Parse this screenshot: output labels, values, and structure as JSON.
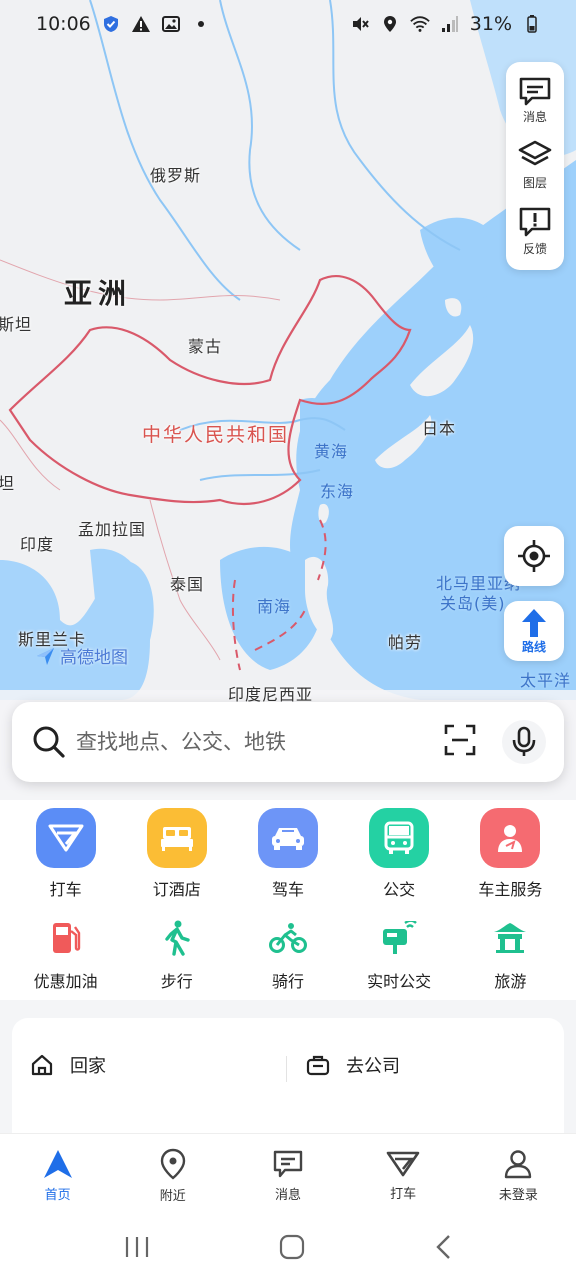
{
  "status_bar": {
    "time": "10:06",
    "battery": "31%"
  },
  "map": {
    "continent_label": "亚洲",
    "labels": {
      "russia": "俄罗斯",
      "mongolia": "蒙古",
      "china": "中华人民共和国",
      "japan": "日本",
      "yellow_sea": "黄海",
      "east_sea": "东海",
      "south_sea": "南海",
      "india": "印度",
      "bangladesh": "孟加拉国",
      "thailand": "泰国",
      "srilanka": "斯里兰卡",
      "indonesia": "印度尼西亚",
      "palau": "帕劳",
      "pacific": "太平洋",
      "n_mariana": "北马里亚纳",
      "guam": "关岛(美)",
      "stan1": "斯坦",
      "stan2": "坦"
    },
    "brand": "高德地图"
  },
  "map_tools": {
    "message": "消息",
    "layers": "图层",
    "feedback": "反馈"
  },
  "route_label": "路线",
  "search": {
    "placeholder": "查找地点、公交、地铁"
  },
  "services_row1": [
    {
      "label": "打车",
      "color": "#5b8df6"
    },
    {
      "label": "订酒店",
      "color": "#fbbd35"
    },
    {
      "label": "驾车",
      "color": "#6d95f7"
    },
    {
      "label": "公交",
      "color": "#24d1a3"
    },
    {
      "label": "车主服务",
      "color": "#f56b71"
    }
  ],
  "services_row2": [
    {
      "label": "优惠加油",
      "color": "#f05a5a"
    },
    {
      "label": "步行",
      "color": "#1fc08f"
    },
    {
      "label": "骑行",
      "color": "#1fc08f"
    },
    {
      "label": "实时公交",
      "color": "#1fc08f"
    },
    {
      "label": "旅游",
      "color": "#1fc08f"
    }
  ],
  "quick": {
    "home": "回家",
    "work": "去公司"
  },
  "bottom_nav": [
    {
      "label": "首页"
    },
    {
      "label": "附近"
    },
    {
      "label": "消息"
    },
    {
      "label": "打车"
    },
    {
      "label": "未登录"
    }
  ]
}
